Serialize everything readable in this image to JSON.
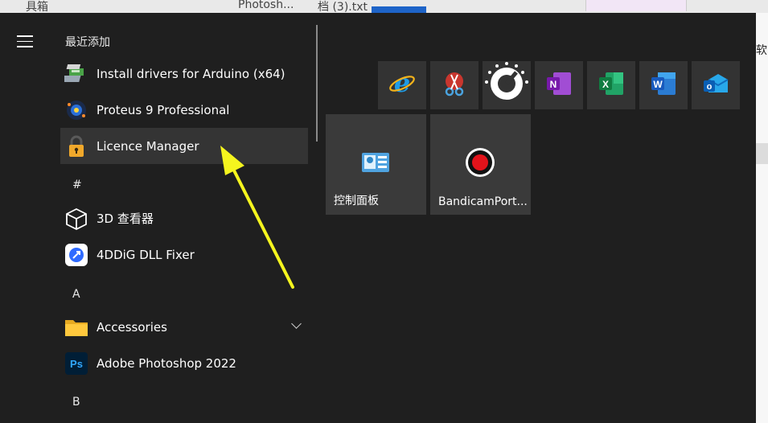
{
  "background": {
    "text_left": "具箱",
    "text_mid": "Photosh...",
    "text_file": "档 (3).txt",
    "text_right": "软"
  },
  "start_menu": {
    "recent_header": "最近添加",
    "recent_items": [
      {
        "label": "Install drivers for Arduino (x64)",
        "icon": "arduino-driver-icon"
      },
      {
        "label": "Proteus 9 Professional",
        "icon": "proteus-icon"
      },
      {
        "label": "Licence Manager",
        "icon": "padlock-icon"
      }
    ],
    "groups": [
      {
        "letter": "#",
        "items": [
          {
            "label": "3D 查看器",
            "icon": "3d-viewer-icon"
          },
          {
            "label": "4DDiG DLL Fixer",
            "icon": "4ddig-icon"
          }
        ]
      },
      {
        "letter": "A",
        "items": [
          {
            "label": "Accessories",
            "icon": "folder-icon"
          },
          {
            "label": "Adobe Photoshop 2022",
            "icon": "photoshop-icon"
          }
        ]
      },
      {
        "letter": "B",
        "items": []
      }
    ],
    "small_tiles": [
      {
        "name": "internet-explorer",
        "icon": "internet-explorer-icon"
      },
      {
        "name": "snipping-tool",
        "icon": "snipping-tool-icon"
      },
      {
        "name": "gauge-app",
        "icon": "gauge-icon"
      },
      {
        "name": "onenote",
        "icon": "onenote-icon",
        "letter": "N"
      },
      {
        "name": "excel",
        "icon": "excel-icon",
        "letter": "X"
      },
      {
        "name": "word",
        "icon": "word-icon",
        "letter": "W"
      },
      {
        "name": "outlook",
        "icon": "outlook-icon",
        "letter": "o"
      }
    ],
    "medium_tiles": [
      {
        "label": "控制面板",
        "icon": "control-panel-icon"
      },
      {
        "label": "BandicamPort...",
        "icon": "record-icon"
      }
    ]
  },
  "colors": {
    "menu_bg": "#1f1f1f",
    "selected_bg": "#343434",
    "arrow": "#f5f51e"
  }
}
